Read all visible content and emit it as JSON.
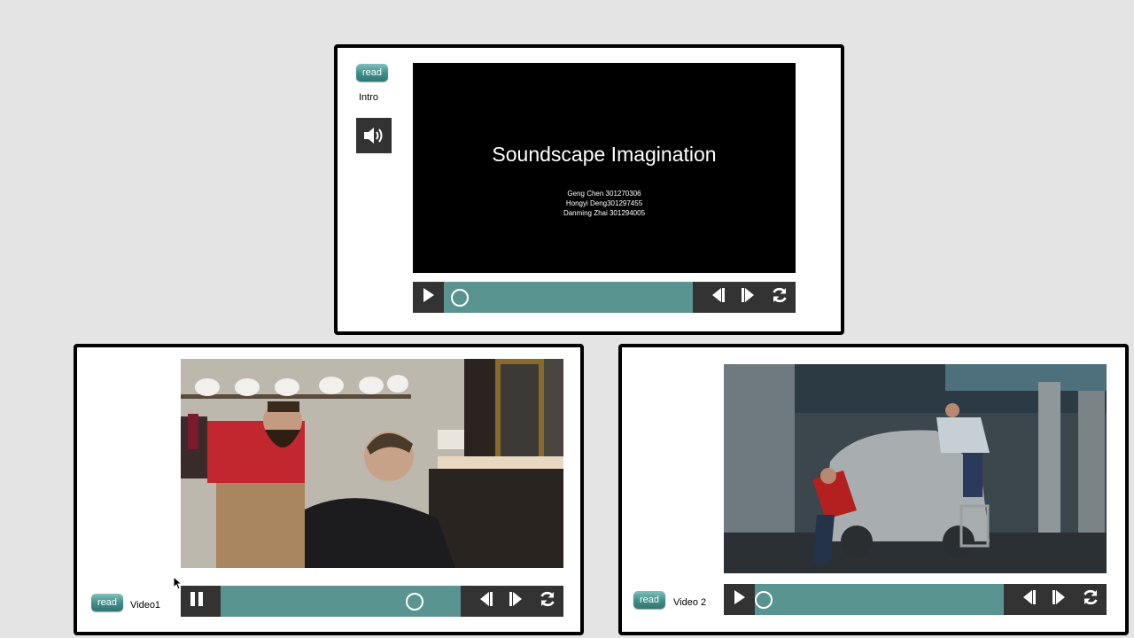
{
  "intro": {
    "read_label": "read",
    "label": "Intro",
    "speaker_icon": "speaker-volume-icon",
    "slide_title": "Soundscape Imagination",
    "authors": [
      "Geng Chen 301270306",
      "Hongyi Deng301297455",
      "Danming Zhai 301294005"
    ],
    "progress": 0.03
  },
  "video1": {
    "read_label": "read",
    "label": "Video1",
    "state": "playing",
    "progress": 0.77,
    "scene": "barbershop"
  },
  "video2": {
    "read_label": "read",
    "label": "Video 2",
    "state": "paused",
    "progress": 0.0,
    "scene": "car-wash"
  },
  "colors": {
    "background": "#e4e4e4",
    "track": "#5a9491",
    "control_bar": "#333333",
    "read_button": "#3f8d89"
  }
}
